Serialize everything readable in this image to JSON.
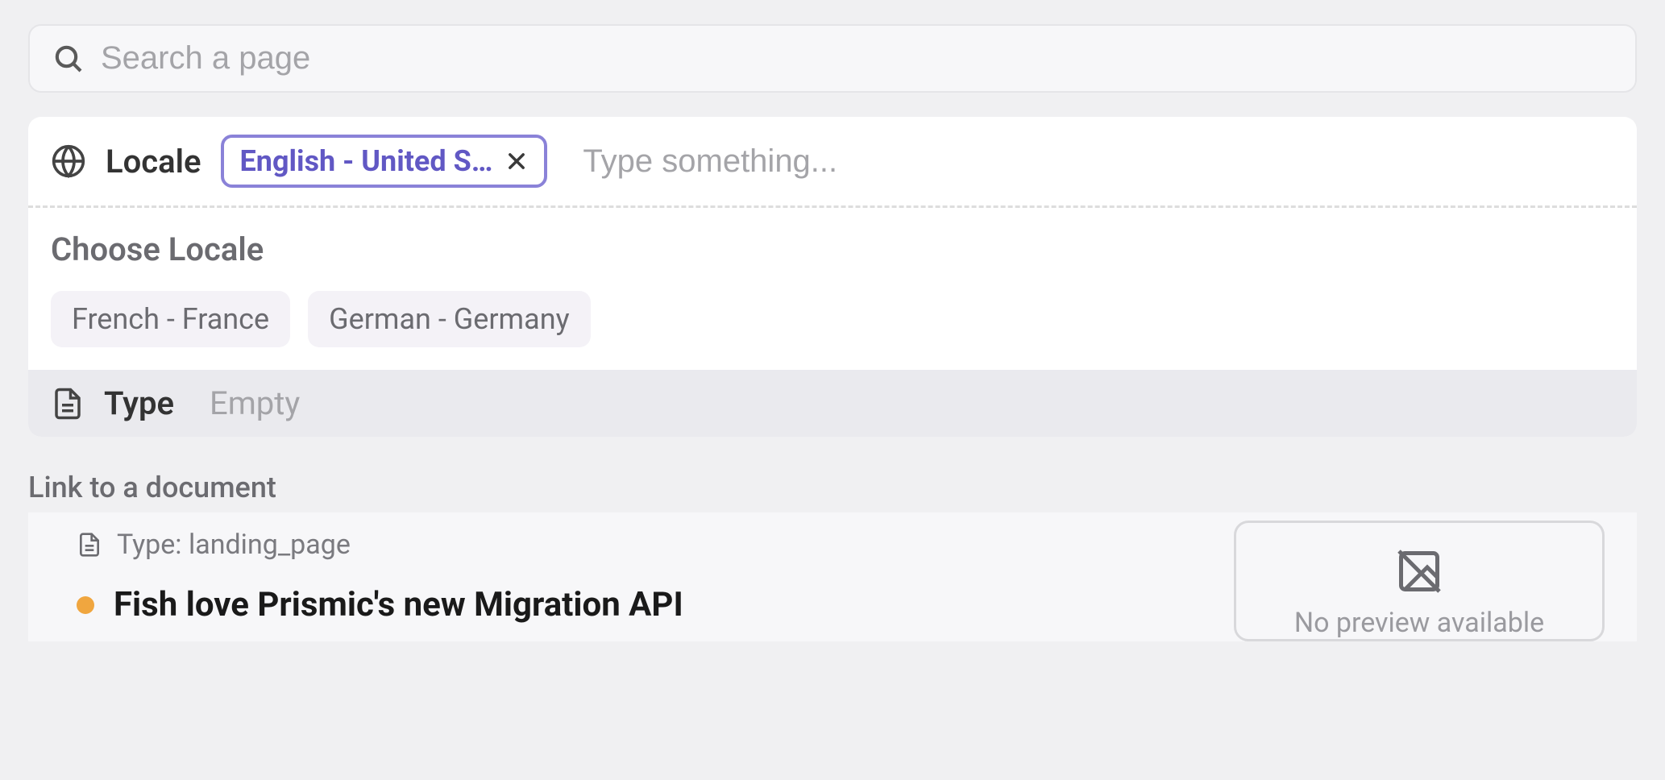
{
  "search": {
    "placeholder": "Search a page",
    "value": ""
  },
  "filters": {
    "locale": {
      "label": "Locale",
      "selected_chip": "English - United S…",
      "type_placeholder": "Type something...",
      "choose_title": "Choose Locale",
      "options": [
        "French - France",
        "German - Germany"
      ]
    },
    "type": {
      "label": "Type",
      "value": "Empty"
    }
  },
  "link_section": {
    "title": "Link to a document",
    "document": {
      "type_label": "Type: landing_page",
      "title": "Fish love Prismic's new Migration API",
      "preview_text": "No preview available",
      "status_color": "#f0a63f"
    }
  }
}
